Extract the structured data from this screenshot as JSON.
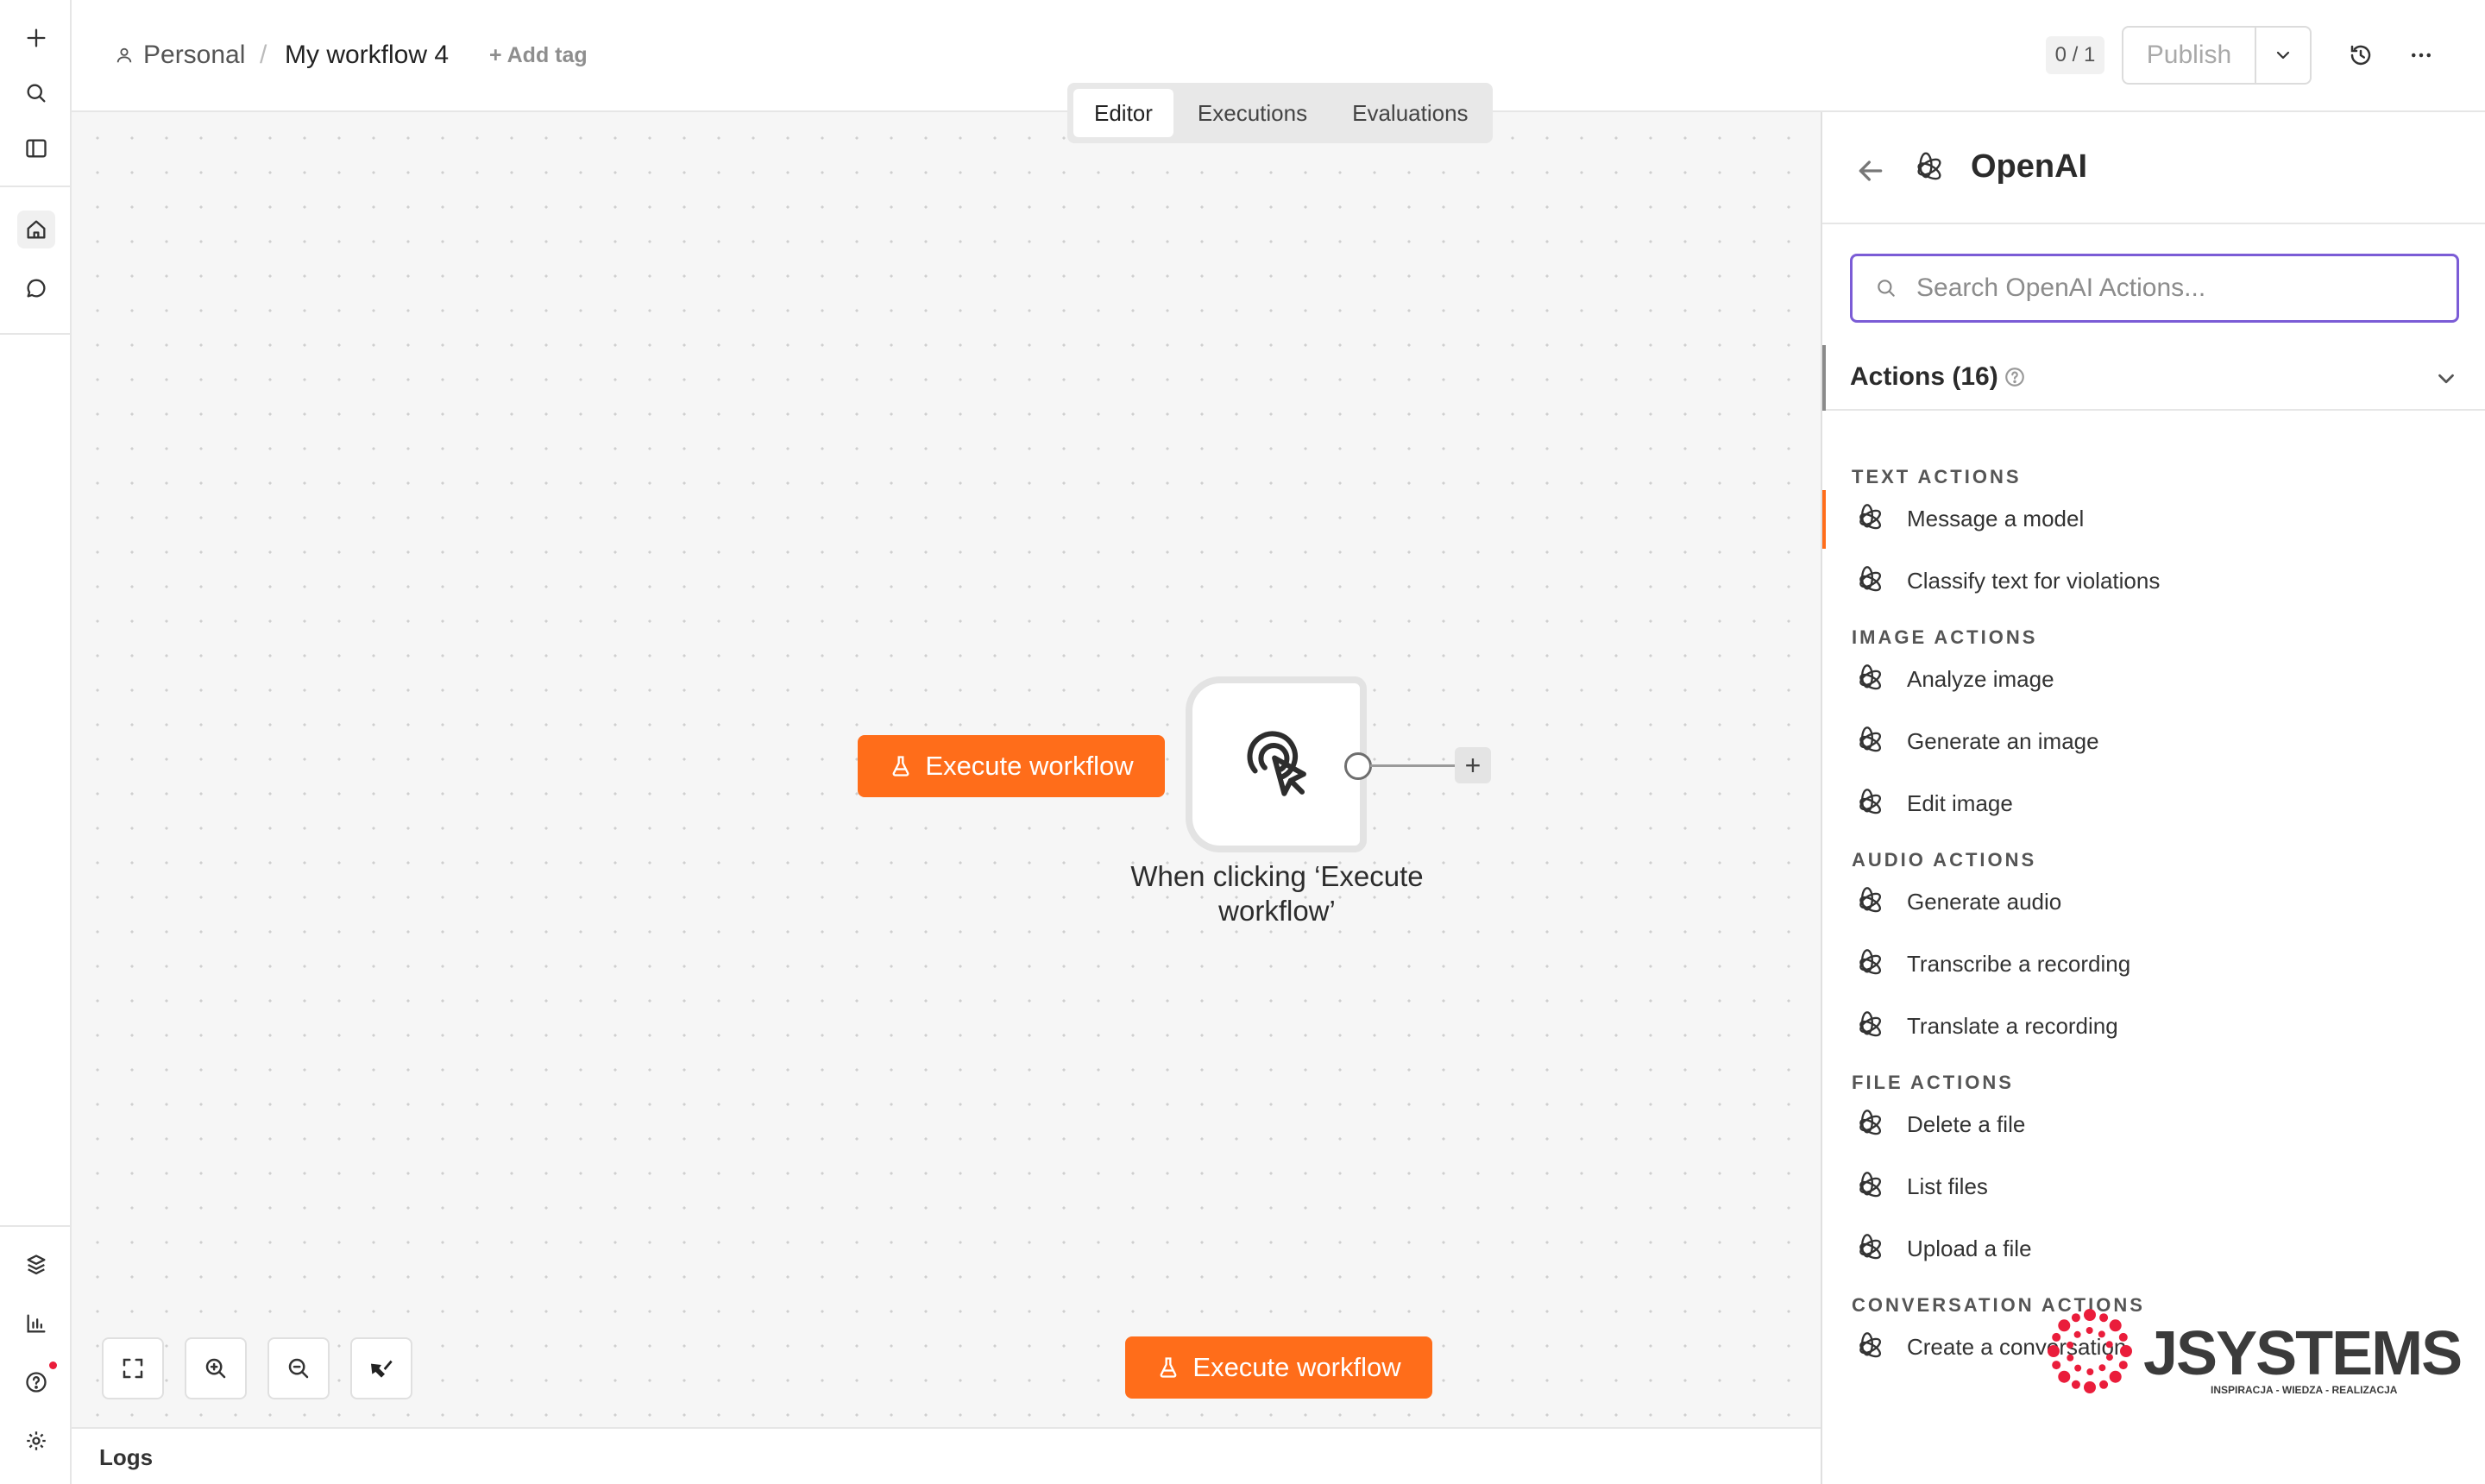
{
  "header": {
    "project": "Personal",
    "separator": "/",
    "workflow_name": "My workflow 4",
    "add_tag": "+ Add tag",
    "counter": "0 / 1",
    "publish": "Publish"
  },
  "tabs": [
    "Editor",
    "Executions",
    "Evaluations"
  ],
  "canvas": {
    "execute_label": "Execute workflow",
    "node_label": "When clicking ‘Execute workflow’",
    "plus": "+"
  },
  "logs": {
    "label": "Logs"
  },
  "panel": {
    "title": "OpenAI",
    "search_placeholder": "Search OpenAI Actions...",
    "actions_header": "Actions (16)",
    "sections": [
      {
        "title": "TEXT ACTIONS",
        "items": [
          "Message a model",
          "Classify text for violations"
        ]
      },
      {
        "title": "IMAGE ACTIONS",
        "items": [
          "Analyze image",
          "Generate an image",
          "Edit image"
        ]
      },
      {
        "title": "AUDIO ACTIONS",
        "items": [
          "Generate audio",
          "Transcribe a recording",
          "Translate a recording"
        ]
      },
      {
        "title": "FILE ACTIONS",
        "items": [
          "Delete a file",
          "List files",
          "Upload a file"
        ]
      },
      {
        "title": "CONVERSATION ACTIONS",
        "items": [
          "Create a conversation"
        ]
      }
    ]
  },
  "watermark": {
    "brand": "JSYSTEMS",
    "tagline": "INSPIRACJA - WIEDZA - REALIZACJA"
  },
  "icons": {
    "rail": [
      "plus-icon",
      "search-icon",
      "sidebar-toggle-icon",
      "home-icon",
      "chat-icon",
      "templates-icon",
      "insights-icon",
      "help-icon",
      "settings-icon"
    ],
    "header": [
      "user-icon",
      "chevron-down-icon",
      "history-icon",
      "more-icon"
    ]
  },
  "colors": {
    "accent": "#ff6d1a",
    "focus": "#7b5cd6",
    "notification": "#ea1d3b"
  }
}
